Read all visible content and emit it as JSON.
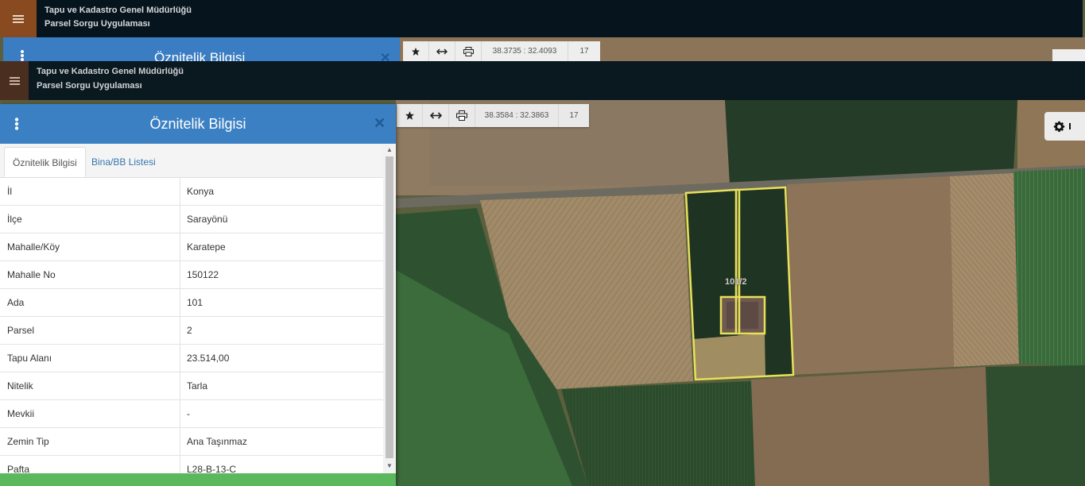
{
  "app": {
    "org_title": "Tapu ve Kadastro Genel Müdürlüğü",
    "app_title": "Parsel Sorgu Uygulaması"
  },
  "ghost": {
    "panel_title": "Öznitelik Bilgisi",
    "coords": "38.3735 : 32.4093",
    "zoom": "17"
  },
  "toolbar": {
    "coords": "38.3584 : 32.3863",
    "zoom": "17"
  },
  "panel": {
    "title": "Öznitelik Bilgisi",
    "close": "×",
    "tabs": [
      {
        "label": "Öznitelik Bilgisi",
        "active": true
      },
      {
        "label": "Bina/BB Listesi",
        "active": false
      }
    ],
    "rows": [
      {
        "key": "İl",
        "value": "Konya"
      },
      {
        "key": "İlçe",
        "value": "Sarayönü"
      },
      {
        "key": "Mahalle/Köy",
        "value": "Karatepe"
      },
      {
        "key": "Mahalle No",
        "value": "150122"
      },
      {
        "key": "Ada",
        "value": "101"
      },
      {
        "key": "Parsel",
        "value": "2"
      },
      {
        "key": "Tapu Alanı",
        "value": "23.514,00"
      },
      {
        "key": "Nitelik",
        "value": "Tarla"
      },
      {
        "key": "Mevkii",
        "value": "-"
      },
      {
        "key": "Zemin Tip",
        "value": "Ana Taşınmaz"
      },
      {
        "key": "Pafta",
        "value": "L28-B-13-C"
      }
    ]
  },
  "map": {
    "parcel_label": "101/2"
  },
  "colors": {
    "header": "#0a1820",
    "panel_header": "#3b80c3",
    "parcel_outline": "#e8e05a",
    "footer": "#5cb85c"
  },
  "icons": [
    "menu-icon",
    "star-icon",
    "arrows-horizontal-icon",
    "print-icon",
    "gear-icon",
    "kebab-icon",
    "close-icon"
  ]
}
